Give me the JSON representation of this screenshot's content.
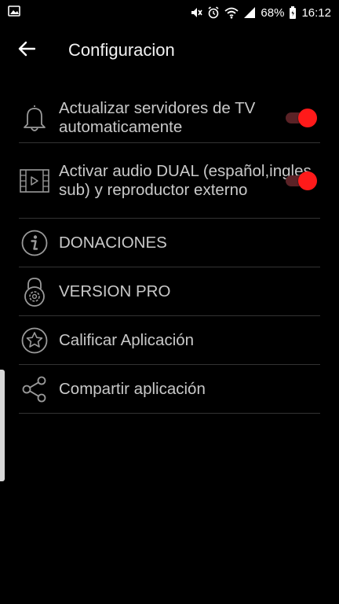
{
  "status_bar": {
    "battery_percent": "68%",
    "time": "16:12"
  },
  "header": {
    "title": "Configuracion"
  },
  "settings": {
    "items": [
      {
        "label": "Actualizar servidores de TV automaticamente",
        "icon": "bell-icon",
        "toggle": true,
        "enabled": true
      },
      {
        "label": "Activar audio DUAL (español,ingles, sub) y reproductor externo",
        "icon": "film-icon",
        "toggle": true,
        "enabled": true
      },
      {
        "label": "DONACIONES",
        "icon": "info-icon"
      },
      {
        "label": "VERSION PRO",
        "icon": "lock-gear-icon"
      },
      {
        "label": "Calificar Aplicación",
        "icon": "star-icon"
      },
      {
        "label": "Compartir aplicación",
        "icon": "share-icon"
      }
    ]
  },
  "colors": {
    "background": "#000000",
    "toggle_on": "#ff1a1a",
    "toggle_track": "#5a2226",
    "divider": "#333333"
  }
}
